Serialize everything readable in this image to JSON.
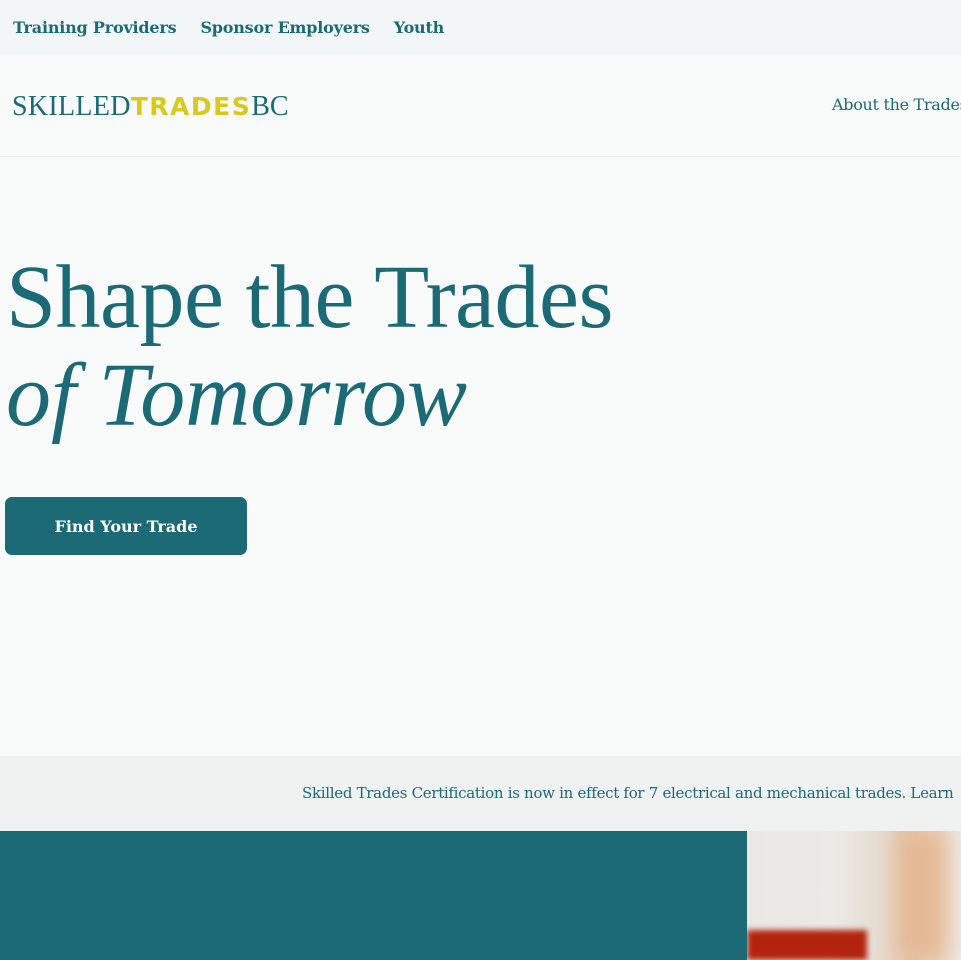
{
  "utility_nav": {
    "items": [
      {
        "label": "Training Providers"
      },
      {
        "label": "Sponsor Employers"
      },
      {
        "label": "Youth"
      }
    ]
  },
  "header": {
    "logo": {
      "part1": "SKILLED",
      "part2": "TRADES",
      "part3": "BC"
    },
    "nav": {
      "about": "About the Trades"
    }
  },
  "hero": {
    "headline_line1": "Shape the Trades",
    "headline_line2": "of Tomorrow",
    "cta_label": "Find Your Trade"
  },
  "announcement": {
    "text": "Skilled Trades Certification is now in effect for 7 electrical and mechanical trades. Learn"
  },
  "colors": {
    "brand_teal": "#1b6a75",
    "brand_yellow": "#d8c91d",
    "page_bg": "#f9fbfb",
    "utility_bg": "#f3f6f7",
    "announce_bg": "#f0f1f1"
  }
}
